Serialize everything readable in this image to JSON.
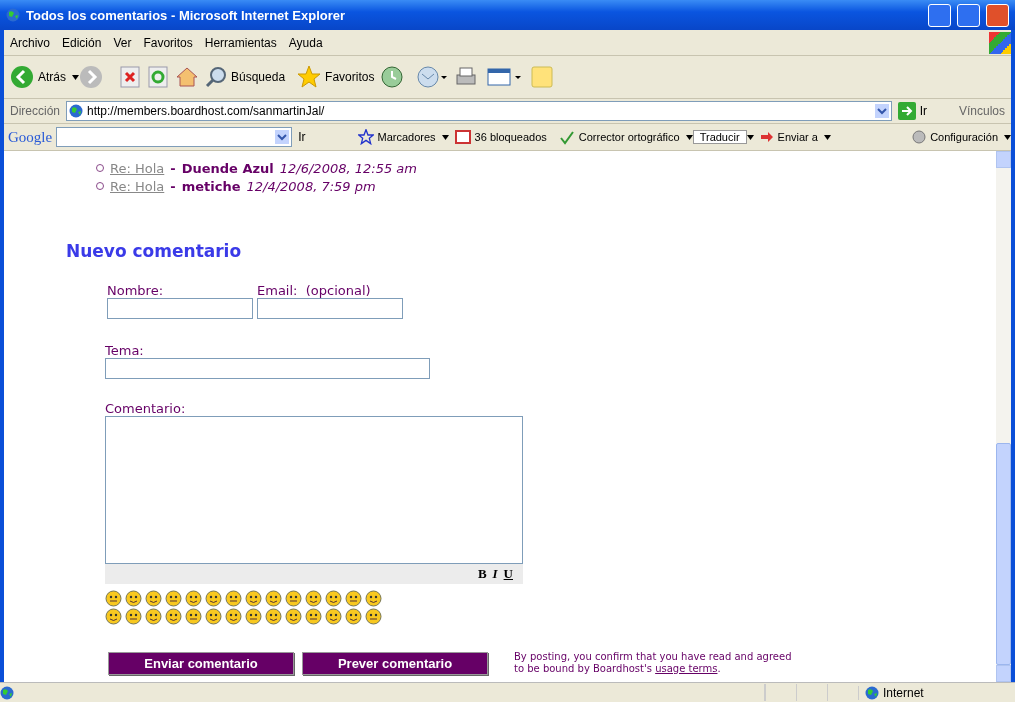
{
  "window": {
    "title": "Todos los comentarios - Microsoft Internet Explorer"
  },
  "menu": [
    "Archivo",
    "Edición",
    "Ver",
    "Favoritos",
    "Herramientas",
    "Ayuda"
  ],
  "toolbar": {
    "back": "Atrás",
    "search": "Búsqueda",
    "favorites": "Favoritos"
  },
  "address": {
    "label": "Dirección",
    "value": "http://members.boardhost.com/sanmartinJal/",
    "go": "Ir",
    "links": "Vínculos"
  },
  "google_bar": {
    "logo": "Google",
    "go": "Ir",
    "bookmarks": "Marcadores",
    "blocked": "36 bloqueados",
    "spell": "Corrector ortográfico",
    "translate": "Traducir",
    "send": "Enviar a",
    "settings": "Configuración"
  },
  "replies": [
    {
      "link": "Re: Hola",
      "separator": "-",
      "author": "Duende Azul",
      "date": "12/6/2008, 12:55 am"
    },
    {
      "link": "Re: Hola",
      "separator": "-",
      "author": "metiche",
      "date": "12/4/2008, 7:59 pm"
    }
  ],
  "form": {
    "heading": "Nuevo comentario",
    "name_label": "Nombre:",
    "email_label": "Email:  (opcional)",
    "subject_label": "Tema:",
    "comment_label": "Comentario:",
    "format": [
      "B",
      "I",
      "U"
    ],
    "submit": "Enviar comentario",
    "preview": "Prever comentario",
    "terms": "By posting, you confirm that you have read and agreed to be bound by Boardhost's",
    "terms_link": "usage terms",
    "terms_end": "."
  },
  "status_bar": {
    "zone": "Internet"
  }
}
